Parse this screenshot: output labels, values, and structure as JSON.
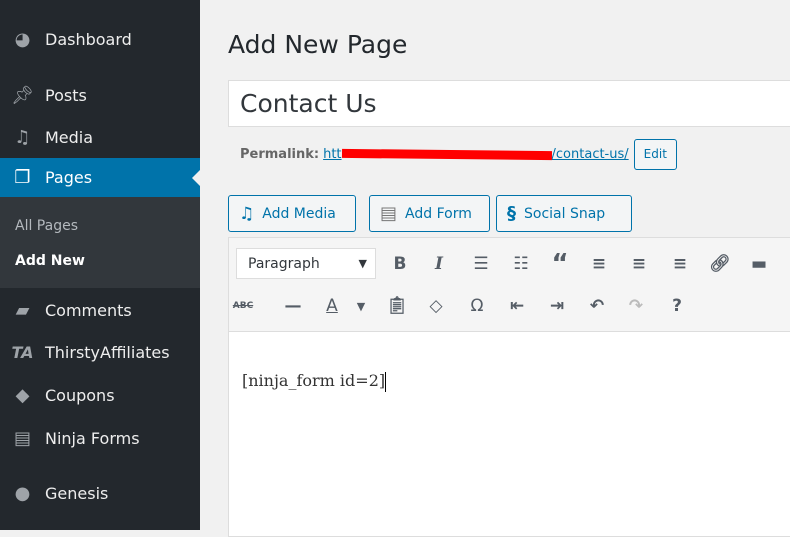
{
  "sidebar": {
    "items": [
      {
        "label": "Dashboard",
        "icon": "dashboard-icon"
      },
      {
        "label": "Posts",
        "icon": "pin-icon"
      },
      {
        "label": "Media",
        "icon": "media-icon"
      },
      {
        "label": "Pages",
        "icon": "pages-icon",
        "active": true
      },
      {
        "label": "Comments",
        "icon": "comment-icon"
      },
      {
        "label": "ThirstyAffiliates",
        "icon": "ta-icon"
      },
      {
        "label": "Coupons",
        "icon": "tag-icon"
      },
      {
        "label": "Ninja Forms",
        "icon": "form-icon"
      },
      {
        "label": "Genesis",
        "icon": "genesis-icon"
      }
    ],
    "submenu": [
      {
        "label": "All Pages"
      },
      {
        "label": "Add New",
        "current": true
      }
    ],
    "accent": "#0073aa"
  },
  "page": {
    "heading": "Add New Page",
    "title_value": "Contact Us",
    "permalink": {
      "label": "Permalink:",
      "link_start": "htt",
      "link_end": "/contact-us/",
      "edit_label": "Edit"
    }
  },
  "media_buttons": {
    "add_media": "Add Media",
    "add_form": "Add Form",
    "social_snap": "Social Snap"
  },
  "toolbar": {
    "format_select": "Paragraph"
  },
  "editor": {
    "content": "[ninja_form id=2]"
  }
}
